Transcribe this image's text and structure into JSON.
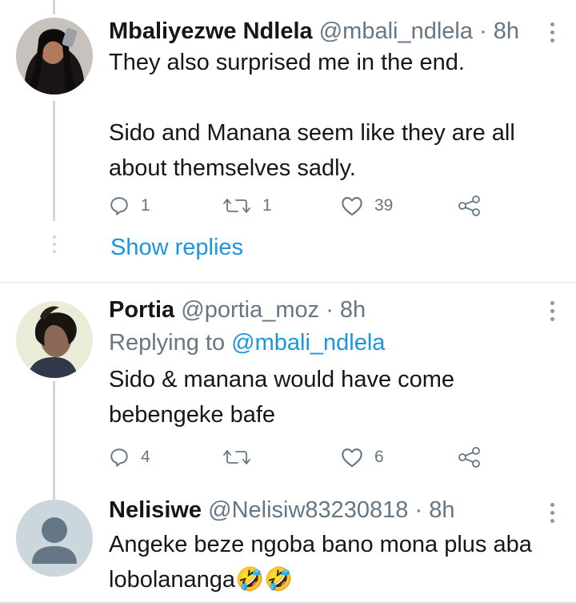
{
  "tweets": [
    {
      "name": "Mbaliyezwe Ndlela",
      "handle": "@mbali_ndlela",
      "time": "· 8h",
      "lines": [
        "They also surprised me in the end.",
        "",
        "Sido and Manana seem like they are all",
        "about themselves sadly."
      ],
      "replies": "1",
      "retweets": "1",
      "likes": "39",
      "show_replies": "Show replies"
    },
    {
      "name": "Portia",
      "handle": "@portia_moz",
      "time": "· 8h",
      "replying_prefix": "Replying to",
      "replying_handle": "@mbali_ndlela",
      "lines": [
        "Sido & manana would have come",
        "bebengeke bafe"
      ],
      "replies": "4",
      "retweets": "",
      "likes": "6"
    },
    {
      "name": "Nelisiwe",
      "handle": "@Nelisiw83230818",
      "time": "· 8h",
      "lines": [
        "Angeke beze ngoba bano mona plus aba",
        "lobolananga🤣🤣"
      ]
    }
  ],
  "icons": {
    "reply": "reply-icon",
    "retweet": "retweet-icon",
    "like": "heart-icon",
    "share": "share-icon",
    "more": "more-vertical-icon"
  },
  "colors": {
    "link": "#1b95e0",
    "muted": "#657786",
    "text": "#14171a"
  }
}
